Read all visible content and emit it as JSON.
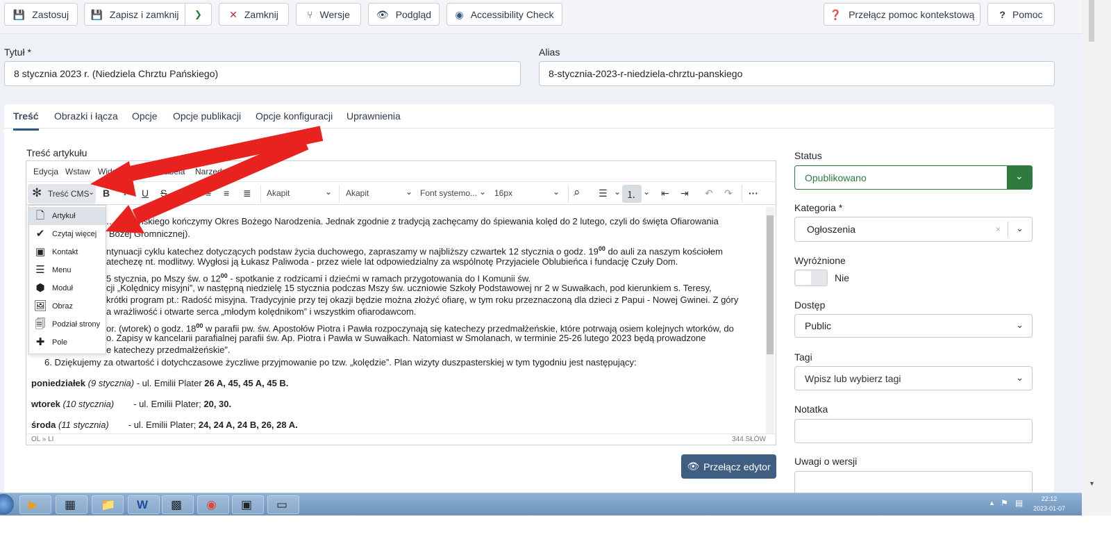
{
  "toolbar": {
    "apply": "Zastosuj",
    "save_close": "Zapisz i zamknij",
    "close": "Zamknij",
    "versions": "Wersje",
    "preview": "Podgląd",
    "accessibility": "Accessibility Check",
    "toggle_help": "Przełącz pomoc kontekstową",
    "help": "Pomoc"
  },
  "form": {
    "title_label": "Tytuł *",
    "title_value": "8 stycznia 2023 r. (Niedziela Chrztu Pańskiego)",
    "alias_label": "Alias",
    "alias_value": "8-stycznia-2023-r-niedziela-chrztu-panskiego"
  },
  "tabs": [
    "Treść",
    "Obrazki i łącza",
    "Opcje",
    "Opcje publikacji",
    "Opcje konfiguracji",
    "Uprawnienia"
  ],
  "editor": {
    "label": "Treść artykułu",
    "menu": [
      "Edycja",
      "Wstaw",
      "Widok",
      "Format",
      "Tabela",
      "Narzędzia"
    ],
    "cms_button": "Treść CMS",
    "format_select1": "Akapit",
    "format_select2": "Akapit",
    "font_select": "Font systemo...",
    "size_select": "16px",
    "path": "OL » LI",
    "wordcount": "344 SŁÓW",
    "toggle_editor": "Przełącz edytor"
  },
  "cms_menu": [
    "Artykuł",
    "Czytaj więcej",
    "Kontakt",
    "Menu",
    "Moduł",
    "Obraz",
    "Podział strony",
    "Pole"
  ],
  "content": {
    "l1": "ziel… tu Pańskiego kończymy Okres Bożego Narodzenia. Jednak zgodnie z tradycją zachęcamy do śpiewania kolęd do 2 lutego, czyli do święta Ofiarowania",
    "l2": "atki Bożej Gromnicznej).",
    "l3": "ntynuacji cyklu katechez dotyczących podstaw życia duchowego, zapraszamy w najbliższy czwartek 12 stycznia o godz. 19",
    "l3b": "00",
    "l3c": " do auli za naszym kościołem",
    "l4": "atechezę nt. modlitwy. Wygłosi ją Łukasz Paliwoda - przez wiele lat odpowiedzialny za wspólnotę Przyjaciele Oblubieńca i fundację Czuły Dom.",
    "l5": "5 stycznia, po Mszy św. o 12",
    "l5b": "00",
    "l5c": " - spotkanie z rodzicami i dziećmi w ramach przygotowania do I Komunii św.",
    "l6": "cji „Kolędnicy misyjni”, w następną niedzielę 15 stycznia podczas Mszy św. uczniowie Szkoły Podstawowej nr 2 w Suwałkach, pod kierunkiem s. Teresy,",
    "l7": "krótki program pt.: Radość misyjna. Tradycyjnie przy tej okazji będzie można złożyć ofiarę, w tym roku przeznaczoną dla dzieci z Papui - Nowej Gwinei. Z góry",
    "l8": "a wrażliwość i otwarte serca „młodym kolędnikom” i wszystkim ofiarodawcom.",
    "l9": "or. (wtorek) o godz. 18",
    "l9b": "00",
    "l9c": " w parafii pw. św. Apostołów Piotra i Pawła rozpoczynają się katechezy przedmałżeńskie, które potrwają osiem kolejnych wtorków, do",
    "l10": "o. Zapisy w kancelarii parafialnej parafii św. Ap. Piotra i Pawła w Suwałkach. Natomiast w Smolanach, w terminie 25-26 lutego 2023 będą prowadzone",
    "l11": "e katechezy przedmałżeńskie”.",
    "l12": "6. Dziękujemy za otwartość i dotychczasowe życzliwe przyjmowanie po tzw. „kolędzie”. Plan wizyty duszpasterskiej w tym tygodniu jest następujący:",
    "d1_day": "poniedziałek",
    "d1_date": "(9 stycznia)",
    "d1_rest": " - ul. Emilii Plater ",
    "d1_nums": "26 A, 45, 45 A, 45 B.",
    "d2_day": "wtorek",
    "d2_date": "(10 stycznia)",
    "d2_rest": "- ul. Emilii Plater;  ",
    "d2_nums": "20, 30.",
    "d3_day": "środa",
    "d3_date": "(11 stycznia)",
    "d3_rest": "- ul. Emilii Plater; ",
    "d3_nums": "24, 24 A, 24 B, 26, 28 A."
  },
  "side": {
    "status_label": "Status",
    "status_value": "Opublikowano",
    "category_label": "Kategoria *",
    "category_value": "Ogłoszenia",
    "featured_label": "Wyróżnione",
    "featured_value": "Nie",
    "access_label": "Dostęp",
    "access_value": "Public",
    "tags_label": "Tagi",
    "tags_placeholder": "Wpisz lub wybierz tagi",
    "note_label": "Notatka",
    "version_label": "Uwagi o wersji"
  },
  "taskbar": {
    "time": "22:12",
    "date": "2023-01-07"
  },
  "colors": {
    "status_green": "#2f7a3f",
    "primary": "#3e5e82",
    "arrow": "#e8231f"
  }
}
